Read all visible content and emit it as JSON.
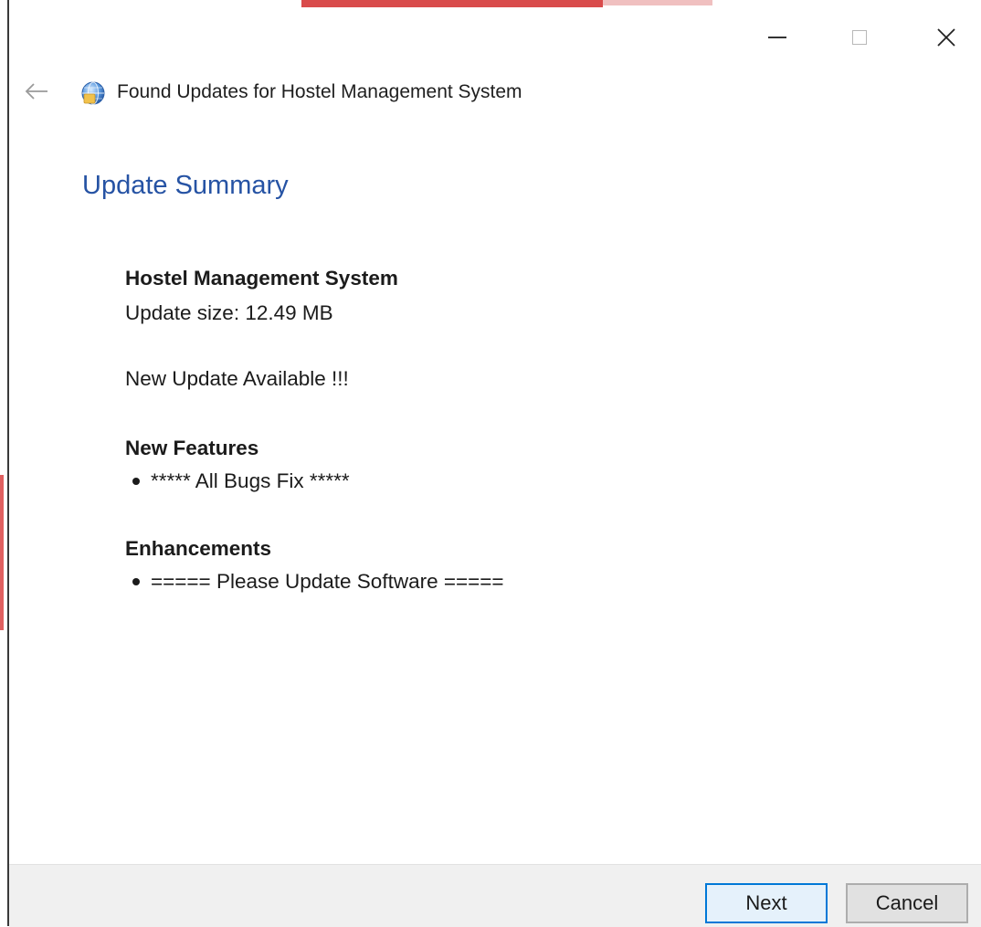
{
  "window": {
    "title": "Found Updates for Hostel Management System",
    "heading": "Update Summary"
  },
  "icons": {
    "back": "back-arrow-icon",
    "app": "globe-app-icon",
    "minimize": "minimize-icon",
    "maximize": "maximize-icon",
    "close": "close-icon"
  },
  "summary": {
    "product_name": "Hostel Management System",
    "update_size": "Update size: 12.49 MB",
    "availability": "New Update Available !!!",
    "new_features_heading": "New Features",
    "new_features": [
      "***** All Bugs Fix *****"
    ],
    "enhancements_heading": "Enhancements",
    "enhancements": [
      "===== Please Update Software ====="
    ]
  },
  "footer": {
    "next_label": "Next",
    "cancel_label": "Cancel"
  },
  "colors": {
    "heading": "#2653a4",
    "focus_border": "#0078d7",
    "footer_bg": "#f0f0f0"
  }
}
